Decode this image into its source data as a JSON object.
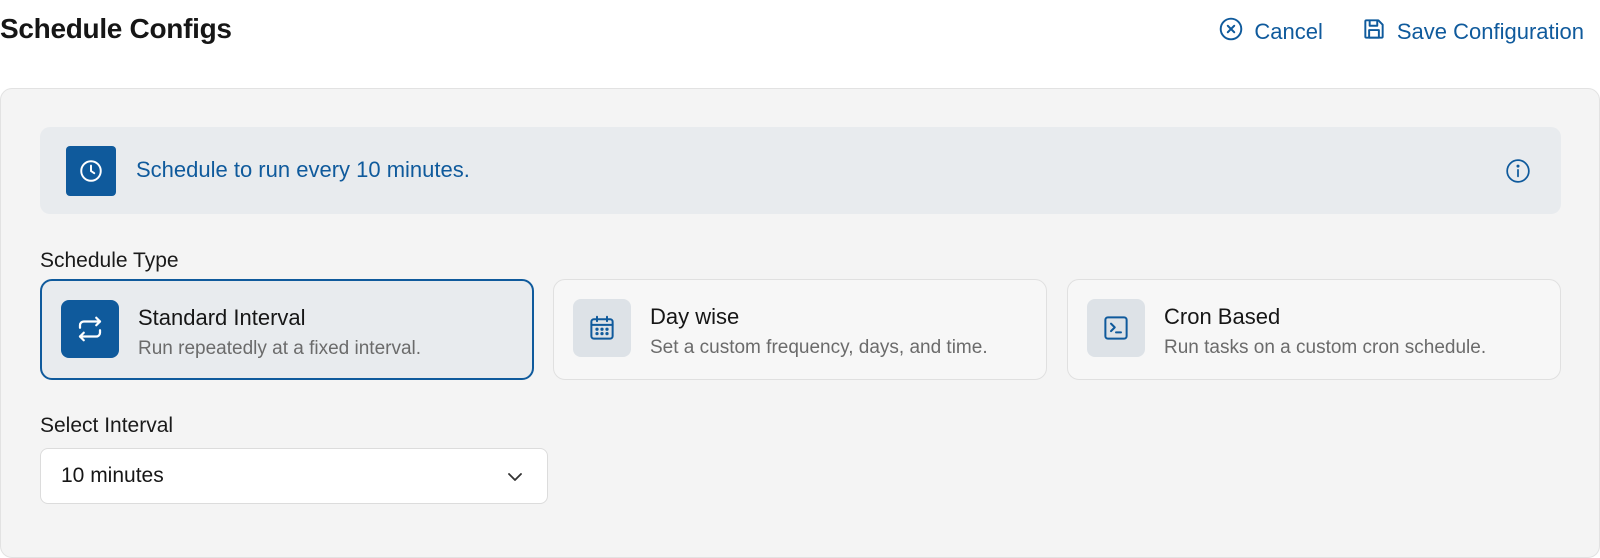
{
  "header": {
    "title": "Schedule Configs",
    "cancel_label": "Cancel",
    "save_label": "Save Configuration"
  },
  "banner": {
    "text": "Schedule to run every 10 minutes.",
    "icon": "clock-icon",
    "info_icon": "info-icon"
  },
  "schedule_type": {
    "label": "Schedule Type",
    "selected": "standard-interval",
    "options": [
      {
        "id": "standard-interval",
        "title": "Standard Interval",
        "description": "Run repeatedly at a fixed interval.",
        "icon": "repeat-icon"
      },
      {
        "id": "day-wise",
        "title": "Day wise",
        "description": "Set a custom frequency, days, and time.",
        "icon": "calendar-icon"
      },
      {
        "id": "cron-based",
        "title": "Cron Based",
        "description": "Run tasks on a custom cron schedule.",
        "icon": "terminal-icon"
      }
    ]
  },
  "interval": {
    "label": "Select Interval",
    "value": "10 minutes"
  },
  "colors": {
    "accent": "#0f5a9c",
    "panel_bg": "#f4f4f4",
    "banner_bg": "#e8ebee"
  }
}
